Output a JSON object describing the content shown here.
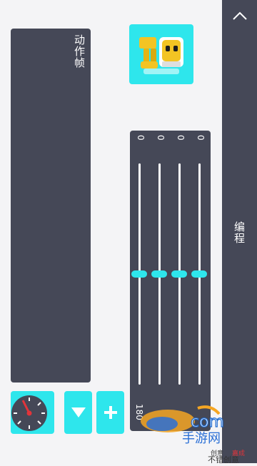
{
  "right_panel": {
    "label": "编程",
    "collapse_icon": "chevron-up-icon"
  },
  "frames_panel": {
    "title": "动作帧"
  },
  "robot_button": {
    "icon": "robot-icon"
  },
  "controls": {
    "speed_icon": "speedometer-icon",
    "down_icon": "triangle-down-icon",
    "add_icon": "plus-icon"
  },
  "servos": {
    "values": [
      "0",
      "0",
      "0",
      "0"
    ],
    "positions": [
      0.5,
      0.5,
      0.5,
      0.5
    ],
    "bottom_label": "180"
  },
  "watermark": {
    "brand": "com",
    "text1": "手游网",
    "text2": "创意",
    "text3": "嘉成",
    "text4": "不错创意"
  },
  "colors": {
    "accent": "#2ee6ec",
    "panel": "#454857",
    "background": "#f4f4f6"
  }
}
